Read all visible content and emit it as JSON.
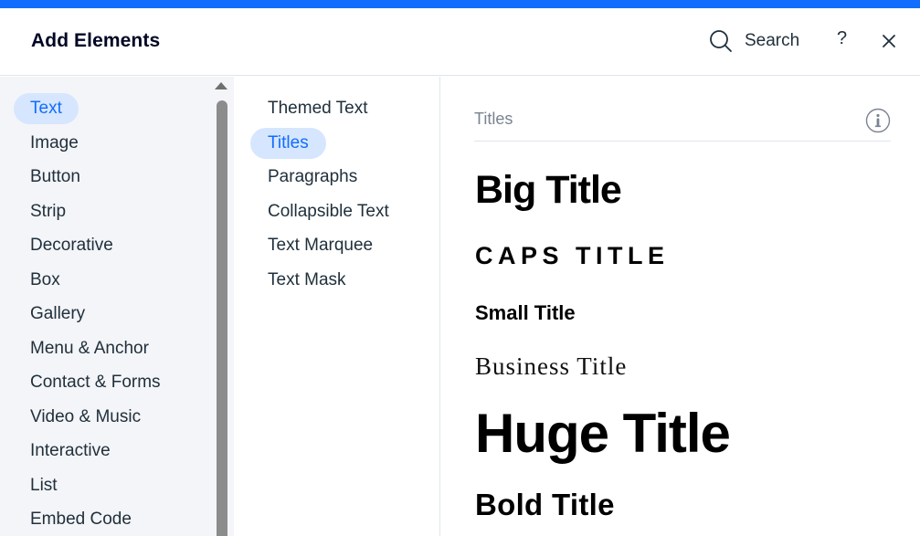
{
  "header": {
    "title": "Add Elements",
    "search_label": "Search",
    "help_label": "?",
    "icons": {
      "search": "search-icon",
      "close": "close-icon",
      "info": "info-icon"
    }
  },
  "categories": [
    {
      "label": "Text",
      "active": true
    },
    {
      "label": "Image"
    },
    {
      "label": "Button"
    },
    {
      "label": "Strip"
    },
    {
      "label": "Decorative"
    },
    {
      "label": "Box"
    },
    {
      "label": "Gallery"
    },
    {
      "label": "Menu & Anchor"
    },
    {
      "label": "Contact & Forms"
    },
    {
      "label": "Video & Music"
    },
    {
      "label": "Interactive"
    },
    {
      "label": "List"
    },
    {
      "label": "Embed Code"
    }
  ],
  "subcategories": [
    {
      "label": "Themed Text"
    },
    {
      "label": "Titles",
      "active": true
    },
    {
      "label": "Paragraphs"
    },
    {
      "label": "Collapsible Text"
    },
    {
      "label": "Text Marquee"
    },
    {
      "label": "Text Mask"
    }
  ],
  "content": {
    "section_title": "Titles",
    "presets": [
      "Big Title",
      "CAPS TITLE",
      "Small Title",
      "Business Title",
      "Huge Title",
      "Bold Title"
    ]
  },
  "colors": {
    "accent": "#116dff",
    "active_bg": "#d6e6fe",
    "sidebar_bg": "#f4f5f8",
    "text": "#20303c"
  }
}
